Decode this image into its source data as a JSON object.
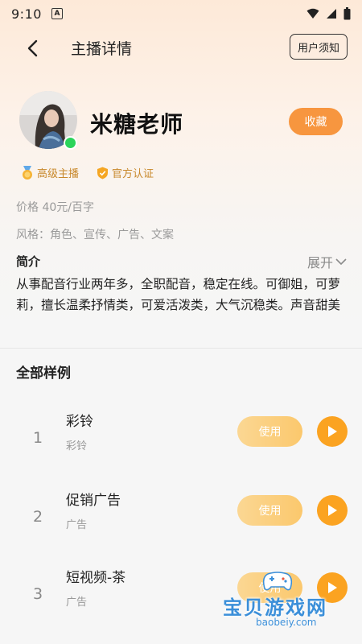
{
  "status": {
    "time": "9:10",
    "notification_icon": "A"
  },
  "nav": {
    "title": "主播详情",
    "notice_label": "用户须知"
  },
  "host": {
    "name": "米糖老师",
    "favorite_label": "收藏",
    "online": true,
    "badges": [
      {
        "icon": "medal-icon",
        "label": "高级主播"
      },
      {
        "icon": "verified-shield-icon",
        "label": "官方认证"
      }
    ],
    "price": "价格 40元/百字",
    "style": "风格：角色、宣传、广告、文案",
    "intro_title": "简介",
    "expand_label": "展开",
    "intro_text": "从事配音行业两年多，全职配音，稳定在线。可御姐，可萝莉，擅长温柔抒情类，可爱活泼类，大气沉稳类。声音甜美"
  },
  "samples": {
    "title": "全部样例",
    "use_label": "使用",
    "items": [
      {
        "index": "1",
        "name": "彩铃",
        "tag": "彩铃"
      },
      {
        "index": "2",
        "name": "促销广告",
        "tag": "广告"
      },
      {
        "index": "3",
        "name": "短视频-茶",
        "tag": "广告"
      }
    ]
  },
  "watermark": {
    "text": "宝贝游戏网",
    "url": "baobeiy.com"
  },
  "colors": {
    "accent": "#f7963f",
    "play": "#fba321",
    "online": "#2bd45a",
    "badge": "#c8882b"
  }
}
